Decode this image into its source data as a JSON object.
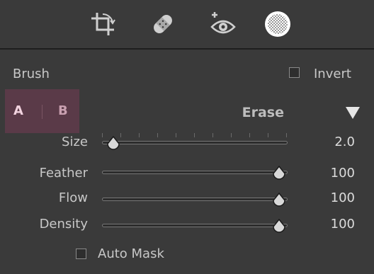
{
  "toolbar": {
    "icons": [
      "crop-icon",
      "healing-bandage-icon",
      "red-eye-icon",
      "masking-circle-icon"
    ]
  },
  "brush": {
    "title": "Brush",
    "invert_label": "Invert",
    "invert_checked": false,
    "brush_a": "A",
    "brush_b": "B",
    "selected_brush": "A",
    "mode": "Erase"
  },
  "sliders": [
    {
      "label": "Size",
      "value_text": "2.0",
      "fraction": 0.05
    },
    {
      "label": "Feather",
      "value_text": "100",
      "fraction": 1.0
    },
    {
      "label": "Flow",
      "value_text": "100",
      "fraction": 1.0
    },
    {
      "label": "Density",
      "value_text": "100",
      "fraction": 1.0
    }
  ],
  "auto_mask": {
    "label": "Auto Mask",
    "checked": false
  },
  "colors": {
    "ab_active": "#5a3a48",
    "letter_a": "#f2d3df",
    "letter_b": "#c9a0b0"
  }
}
